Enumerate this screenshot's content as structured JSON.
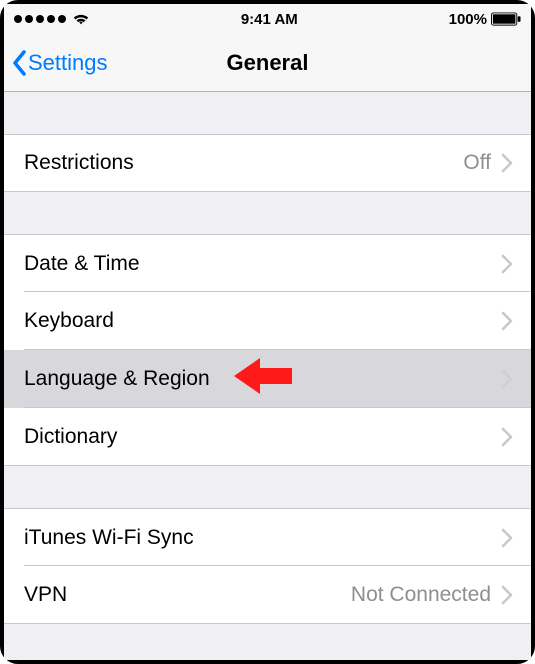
{
  "status_bar": {
    "time": "9:41 AM",
    "battery_text": "100%"
  },
  "nav": {
    "back_label": "Settings",
    "title": "General"
  },
  "rows": {
    "restrictions": {
      "label": "Restrictions",
      "value": "Off"
    },
    "date_time": {
      "label": "Date & Time"
    },
    "keyboard": {
      "label": "Keyboard"
    },
    "language_region": {
      "label": "Language & Region"
    },
    "dictionary": {
      "label": "Dictionary"
    },
    "itunes_wifi_sync": {
      "label": "iTunes Wi-Fi Sync"
    },
    "vpn": {
      "label": "VPN",
      "value": "Not Connected"
    }
  },
  "annotation": {
    "target": "language_region",
    "color": "#ff1a1a"
  }
}
